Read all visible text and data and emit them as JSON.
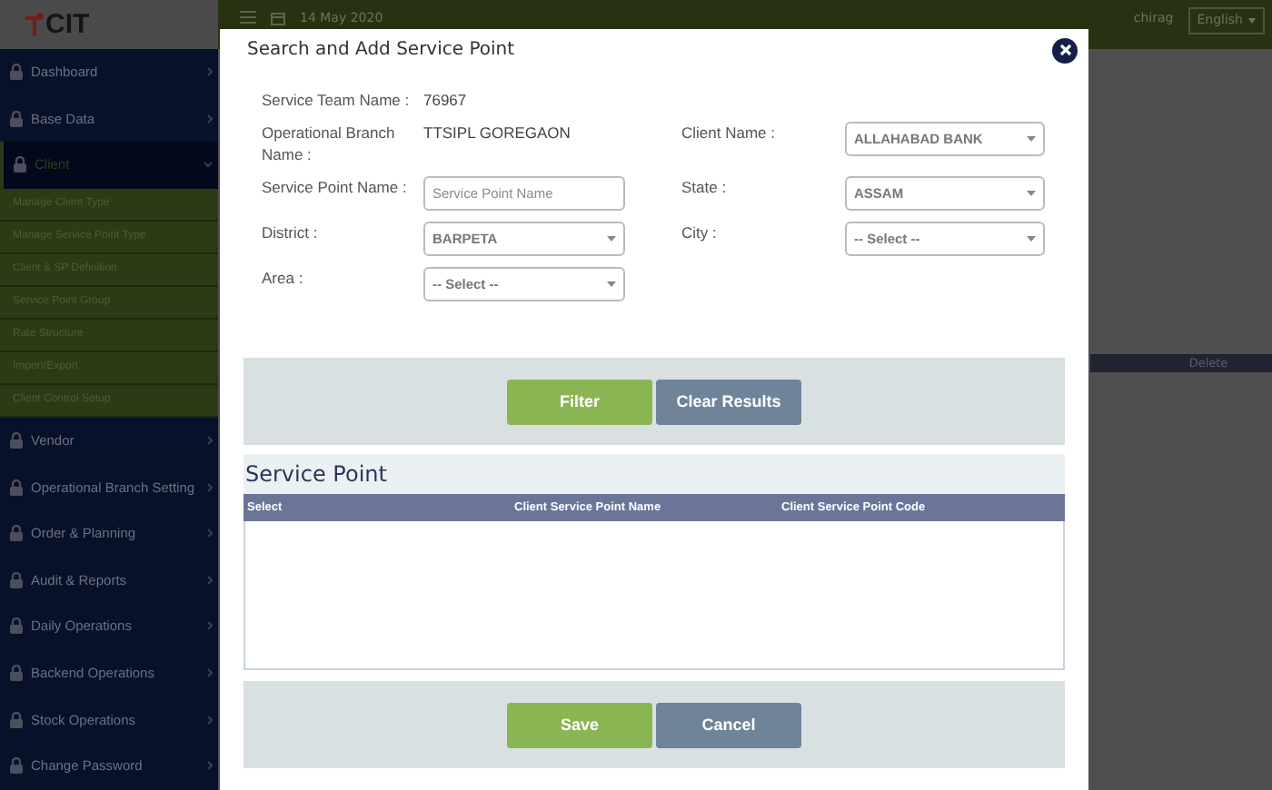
{
  "sidebar": {
    "logo": "CIT",
    "items": [
      {
        "label": "Dashboard",
        "selected": false,
        "expanded": false
      },
      {
        "label": "Base Data",
        "selected": false,
        "expanded": false
      },
      {
        "label": "Client",
        "selected": true,
        "expanded": true,
        "children": [
          {
            "label": "Manage Client Type"
          },
          {
            "label": "Manage Service Point Type"
          },
          {
            "label": "Client & SP Definition"
          },
          {
            "label": "Service Point Group"
          },
          {
            "label": "Rate Structure"
          },
          {
            "label": "Import/Export"
          },
          {
            "label": "Client Control Setup"
          }
        ]
      },
      {
        "label": "Vendor",
        "selected": false,
        "expanded": false
      },
      {
        "label": "Operational Branch Setting",
        "selected": false,
        "expanded": false
      },
      {
        "label": "Order & Planning",
        "selected": false,
        "expanded": false
      },
      {
        "label": "Audit & Reports",
        "selected": false,
        "expanded": false
      },
      {
        "label": "Daily Operations",
        "selected": false,
        "expanded": false
      },
      {
        "label": "Backend Operations",
        "selected": false,
        "expanded": false
      },
      {
        "label": "Stock Operations",
        "selected": false,
        "expanded": false
      },
      {
        "label": "Change Password",
        "selected": false,
        "expanded": false
      }
    ]
  },
  "header": {
    "date": "14 May 2020",
    "user": "chirag",
    "language": "English"
  },
  "background_table": {
    "columns": [
      "Delete"
    ]
  },
  "modal": {
    "title": "Search and Add Service Point",
    "form_rows": [
      [
        {
          "label": "Service Team Name :",
          "kind": "text",
          "value": "76967"
        }
      ],
      [
        {
          "label": "Operational Branch Name :",
          "kind": "text",
          "value": "TTSIPL GOREGAON"
        },
        {
          "label": "Client Name :",
          "kind": "select",
          "value": "ALLAHABAD BANK"
        }
      ],
      [
        {
          "label": "Service Point Name :",
          "kind": "input",
          "placeholder": "Service Point Name"
        },
        {
          "label": "State :",
          "kind": "select",
          "value": "ASSAM"
        }
      ],
      [
        {
          "label": "District :",
          "kind": "select",
          "value": "BARPETA"
        },
        {
          "label": "City :",
          "kind": "select",
          "value": "-- Select --"
        }
      ],
      [
        {
          "label": "Area :",
          "kind": "select",
          "value": "-- Select --"
        }
      ]
    ],
    "filter_buttons": [
      {
        "label": "Filter",
        "kind": "primary"
      },
      {
        "label": "Clear Results",
        "kind": "secondary"
      }
    ],
    "results": {
      "title": "Service Point",
      "columns": [
        "Select",
        "Client Service Point Name",
        "Client Service Point Code"
      ]
    },
    "footer_buttons": [
      {
        "label": "Save",
        "kind": "primary"
      },
      {
        "label": "Cancel",
        "kind": "secondary"
      }
    ]
  }
}
